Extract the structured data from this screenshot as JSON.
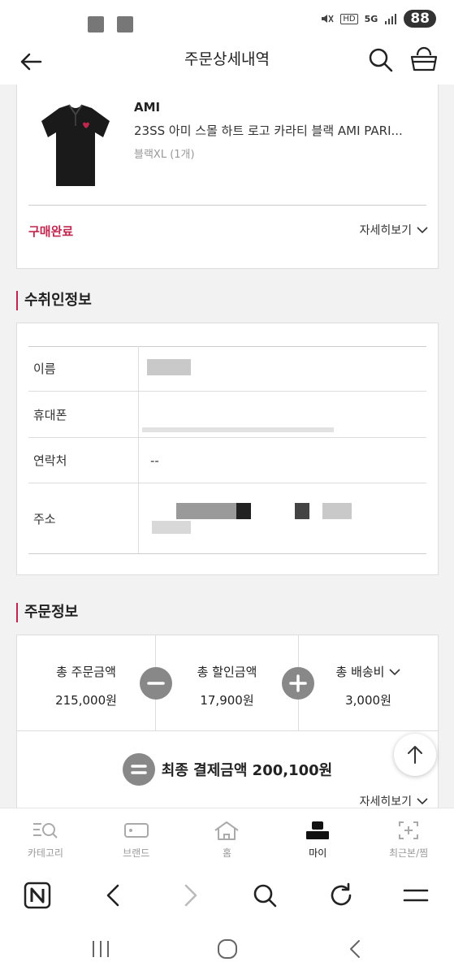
{
  "status_bar": {
    "battery": "88",
    "icons": [
      "mute-icon",
      "hd-icon",
      "5g-icon",
      "signal-icon",
      "battery-icon"
    ],
    "hd": "HD",
    "network": "5G"
  },
  "header": {
    "title": "주문상세내역",
    "icons": [
      "back-arrow-icon",
      "search-icon",
      "cart-icon"
    ]
  },
  "product": {
    "brand": "AMI",
    "name": "23SS 아미 스몰 하트 로고 카라티 블랙 AMI PARI...",
    "option": "블랙XL (1개)",
    "status": "구매완료",
    "detail_label": "자세히보기"
  },
  "recipient": {
    "section_title": "수취인정보",
    "rows": [
      {
        "label": "이름",
        "value": ""
      },
      {
        "label": "휴대폰",
        "value": ""
      },
      {
        "label": "연락처",
        "value": "--"
      },
      {
        "label": "주소",
        "value": ""
      }
    ]
  },
  "order": {
    "section_title": "주문정보",
    "total_order_label": "총 주문금액",
    "total_order_value": "215,000원",
    "total_discount_label": "총 할인금액",
    "total_discount_value": "17,900원",
    "total_shipping_label": "총 배송비",
    "total_shipping_value": "3,000원",
    "final_label": "최종 결제금액 200,100원",
    "detail_label": "자세히보기"
  },
  "bottom_nav": {
    "items": [
      {
        "label": "카테고리",
        "icon": "category-search-icon"
      },
      {
        "label": "브랜드",
        "icon": "brand-tag-icon"
      },
      {
        "label": "홈",
        "icon": "home-icon"
      },
      {
        "label": "마이",
        "icon": "my-person-icon"
      },
      {
        "label": "최근본/찜",
        "icon": "recent-icon"
      }
    ],
    "active": "마이"
  },
  "browser_toolbar": {
    "icons": [
      "naver-n-icon",
      "browser-back-icon",
      "browser-forward-icon",
      "browser-search-icon",
      "refresh-icon",
      "menu-icon"
    ]
  },
  "system_nav": {
    "icons": [
      "recent-apps-icon",
      "home-circle-icon",
      "system-back-icon"
    ]
  },
  "colors": {
    "accent": "#c0264e",
    "background": "#f2f2f2"
  }
}
